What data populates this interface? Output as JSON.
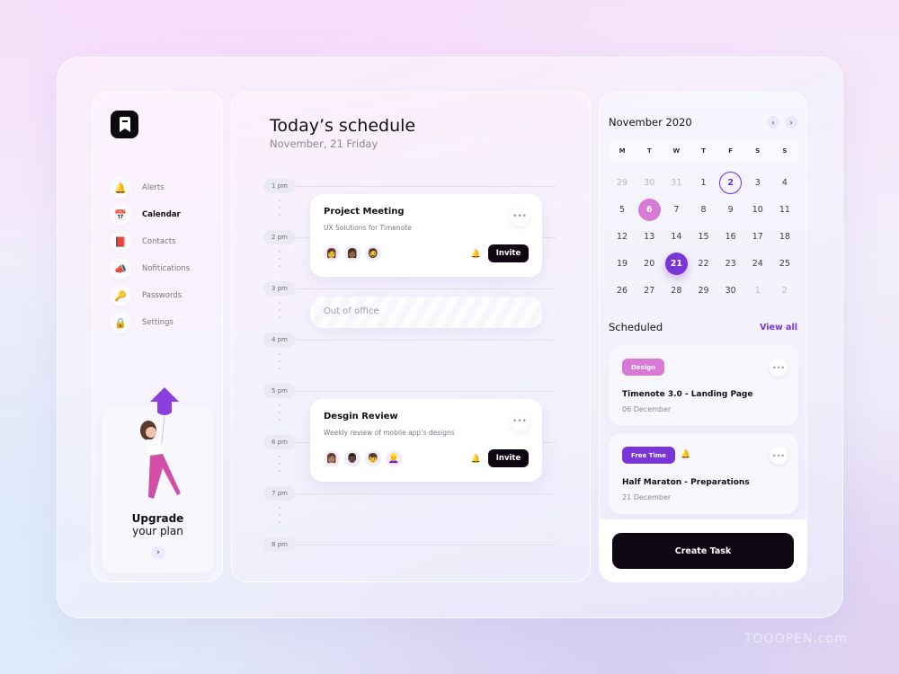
{
  "sidebar": {
    "logo": "bookmark-logo",
    "items": [
      {
        "label": "Alerts",
        "icon": "bell-icon",
        "glyph": "🔔",
        "active": false
      },
      {
        "label": "Calendar",
        "icon": "calendar-icon",
        "glyph": "📅",
        "active": true
      },
      {
        "label": "Contacts",
        "icon": "contacts-book-icon",
        "glyph": "📕",
        "active": false
      },
      {
        "label": "Nofitications",
        "icon": "megaphone-icon",
        "glyph": "📣",
        "active": false
      },
      {
        "label": "Passwords",
        "icon": "key-icon",
        "glyph": "🔑",
        "active": false
      },
      {
        "label": "Settings",
        "icon": "lock-icon",
        "glyph": "🔒",
        "active": false
      }
    ],
    "upgrade": {
      "title": "Upgrade",
      "subtitle": "your plan",
      "arrow": "›"
    }
  },
  "main": {
    "title": "Today’s schedule",
    "subtitle": "November, 21 Friday",
    "times": [
      "1 pm",
      "2 pm",
      "3 pm",
      "4 pm",
      "5 pm",
      "6 pm",
      "7 pm",
      "8 pm"
    ],
    "events": [
      {
        "title": "Project Meeting",
        "subtitle": "UX Solutions for Timenote",
        "more": "•••",
        "invite": "Invite",
        "bell": "🔔",
        "avatars": [
          {
            "glyph": "👩",
            "bg": "#f6e9f8"
          },
          {
            "glyph": "👩🏾",
            "bg": "#efecf8"
          },
          {
            "glyph": "🧔",
            "bg": "#e9f0fb"
          }
        ]
      },
      {
        "title": "Desgin Review",
        "subtitle": "Weekly review of mobile app’s designs",
        "more": "•••",
        "invite": "Invite",
        "bell": "🔔",
        "avatars": [
          {
            "glyph": "👩🏽",
            "bg": "#f6e9f8"
          },
          {
            "glyph": "👨🏿",
            "bg": "#efecf8"
          },
          {
            "glyph": "👦",
            "bg": "#e9f0fb"
          },
          {
            "glyph": "👱‍♀️",
            "bg": "#f6e9f8"
          }
        ]
      }
    ],
    "out_of_office": "Out of office"
  },
  "calendar": {
    "month": "November 2020",
    "prev": "‹",
    "next": "›",
    "weekdays": [
      "M",
      "T",
      "W",
      "T",
      "F",
      "S",
      "S"
    ],
    "days": [
      {
        "d": "29",
        "muted": true
      },
      {
        "d": "30",
        "muted": true
      },
      {
        "d": "31",
        "muted": true
      },
      {
        "d": "1"
      },
      {
        "d": "2",
        "style": "outlined"
      },
      {
        "d": "3"
      },
      {
        "d": "4"
      },
      {
        "d": "5"
      },
      {
        "d": "6",
        "style": "pink"
      },
      {
        "d": "7"
      },
      {
        "d": "8"
      },
      {
        "d": "9"
      },
      {
        "d": "10"
      },
      {
        "d": "11"
      },
      {
        "d": "12"
      },
      {
        "d": "13"
      },
      {
        "d": "14"
      },
      {
        "d": "15"
      },
      {
        "d": "16"
      },
      {
        "d": "17"
      },
      {
        "d": "18"
      },
      {
        "d": "19"
      },
      {
        "d": "20"
      },
      {
        "d": "21",
        "style": "purple"
      },
      {
        "d": "22"
      },
      {
        "d": "23"
      },
      {
        "d": "24"
      },
      {
        "d": "25"
      },
      {
        "d": "26"
      },
      {
        "d": "27"
      },
      {
        "d": "28"
      },
      {
        "d": "29"
      },
      {
        "d": "30"
      },
      {
        "d": "1",
        "muted": true
      },
      {
        "d": "2",
        "muted": true
      }
    ]
  },
  "scheduled": {
    "title": "Scheduled",
    "view_all": "View all",
    "tasks": [
      {
        "tag": "Design",
        "tag_color": "#d77ad6",
        "title": "Timenote 3.0 - Landing Page",
        "date": "06 December",
        "more": "•••",
        "bell": false
      },
      {
        "tag": "Free Time",
        "tag_color": "#7a35d8",
        "title": "Half Maraton - Preparations",
        "date": "21 December",
        "more": "•••",
        "bell": true
      }
    ],
    "create_task": "Create Task"
  },
  "colors": {
    "accent": "#7a35d8",
    "pink": "#d77ad6",
    "dark": "#0f0812"
  },
  "watermark": "TOOOPEN.com"
}
